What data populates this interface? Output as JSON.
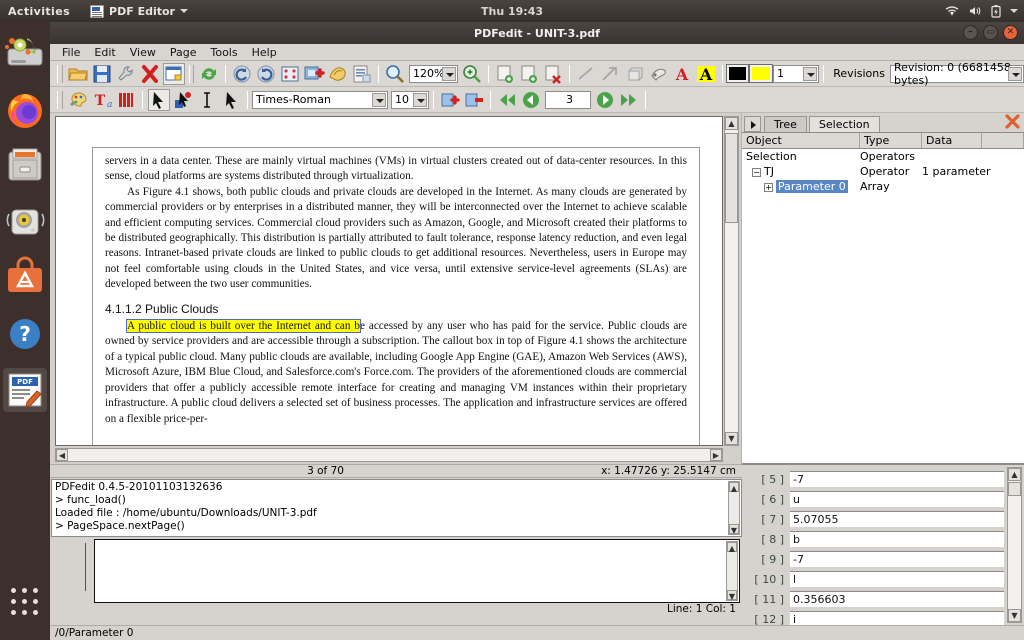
{
  "topbar": {
    "activities": "Activities",
    "app_menu": "PDF Editor",
    "clock": "Thu 19:43",
    "icons": [
      "wifi-icon",
      "volume-icon",
      "battery-icon",
      "chevron-down-icon"
    ]
  },
  "launcher": {
    "items": [
      {
        "name": "ubuntu-installer-icon"
      },
      {
        "name": "firefox-icon"
      },
      {
        "name": "file-manager-icon"
      },
      {
        "name": "rhythmbox-icon"
      },
      {
        "name": "ubuntu-software-icon"
      },
      {
        "name": "help-icon"
      },
      {
        "name": "pdf-editor-icon",
        "label": "PDF Editor",
        "selected": true
      }
    ],
    "show_apps": "show-applications-icon"
  },
  "window": {
    "title": "PDFedit - UNIT-3.pdf",
    "buttons": [
      "minimize",
      "maximize",
      "close"
    ]
  },
  "menubar": [
    "File",
    "Edit",
    "View",
    "Page",
    "Tools",
    "Help"
  ],
  "toolbar1": {
    "zoom_value": "120%",
    "line_width_value": "1",
    "revisions_label": "Revisions",
    "revision_value": "Revision: 0 (6681458 bytes)",
    "fg_color": "#000000",
    "hl_color": "#ffff00",
    "icons": [
      "open-icon",
      "save-icon",
      "settings-icon",
      "close-document-icon",
      "new-page-icon",
      "reload-icon",
      "undo-icon",
      "redo-icon",
      "select-all-icon",
      "add-object-icon",
      "edit-object-icon",
      "properties-icon",
      "zoom-out-icon",
      "zoom-in-icon",
      "page-add-icon",
      "page-add2-icon",
      "page-delete-icon",
      "line-icon",
      "arrow-icon",
      "rect-icon",
      "stamp-icon",
      "text-color-icon",
      "highlight-color-icon"
    ]
  },
  "toolbar2": {
    "font_value": "Times-Roman",
    "size_value": "10",
    "page_value": "3",
    "icons": [
      "color-tool-icon",
      "font-tool-icon",
      "highlight-tool-icon",
      "select-cursor-icon",
      "move-object-icon",
      "text-cursor-icon",
      "select-objects-icon",
      "insert-page-icon",
      "delete-page-icon",
      "first-page-icon",
      "prev-page-icon",
      "next-page-icon",
      "last-page-icon"
    ]
  },
  "document": {
    "paragraphs": [
      "servers in a data center. These are mainly virtual machines (VMs) in virtual clusters created out of data-center resources. In this sense, cloud platforms are systems distributed through virtualization.",
      "As Figure 4.1 shows, both public clouds and private clouds are developed in the Internet. As many clouds are generated by commercial providers or by enterprises in a distributed manner, they will be interconnected over the Internet to achieve scalable and efficient computing services. Commercial cloud providers such as Amazon, Google, and Microsoft created their platforms to be distributed geographically. This distribution is partially attributed to fault tolerance, response latency reduction, and even legal reasons. Intranet-based private clouds are linked to public clouds to get additional resources. Nevertheless, users in Europe may not feel comfortable using clouds in the United States, and vice versa, until extensive service-level agreements (SLAs) are developed between the two user communities."
    ],
    "heading": "4.1.1.2 Public Clouds",
    "highlighted_text": "A public cloud is built over the Internet and can b",
    "body_after_highlight": "e accessed by any user who has paid for the service. Public clouds are owned by service providers and are accessible through a subscription. The callout box in top of Figure 4.1 shows the architecture of a typical public cloud. Many public clouds are available, including Google App Engine (GAE), Amazon Web Services (AWS), Microsoft Azure, IBM Blue Cloud, and Salesforce.com's Force.com. The providers of the aforementioned clouds are commercial providers that offer a publicly accessible remote interface for creating and managing VM instances within their proprietary infrastructure. A public cloud delivers a selected set of business processes. The application and infrastructure services are offered on a flexible price-per-"
  },
  "page_status": {
    "page_of": "3 of 70",
    "coords": "x: 1.47726 y: 25.5147 cm"
  },
  "tree_panel": {
    "tabs": [
      "Tree",
      "Selection"
    ],
    "active_tab": "Selection",
    "columns": [
      "Object",
      "Type",
      "Data"
    ],
    "rows": [
      {
        "object": "Selection",
        "type": "Operators",
        "data": "",
        "indent": 0,
        "expander": "",
        "selected": false
      },
      {
        "object": "TJ",
        "type": "Operator",
        "data": "1 parameter",
        "indent": 1,
        "expander": "-",
        "selected": false
      },
      {
        "object": "Parameter 0",
        "type": "Array",
        "data": "",
        "indent": 2,
        "expander": "+",
        "selected": true
      }
    ]
  },
  "parameters": [
    {
      "index": "[   5 ]",
      "value": "-7"
    },
    {
      "index": "[   6 ]",
      "value": "u"
    },
    {
      "index": "[   7 ]",
      "value": "5.07055"
    },
    {
      "index": "[   8 ]",
      "value": "b"
    },
    {
      "index": "[   9 ]",
      "value": "-7"
    },
    {
      "index": "[  10 ]",
      "value": "l"
    },
    {
      "index": "[  11 ]",
      "value": "0.356603"
    },
    {
      "index": "[  12 ]",
      "value": "i"
    }
  ],
  "console": {
    "lines": [
      "PDFedit 0.4.5-20101103132636",
      "> func_load()",
      "Loaded file : /home/ubuntu/Downloads/UNIT-3.pdf",
      "> PageSpace.nextPage()"
    ],
    "command_value": ""
  },
  "line_info": "Line: 1 Col: 1",
  "path_bar": "/0/Parameter 0"
}
